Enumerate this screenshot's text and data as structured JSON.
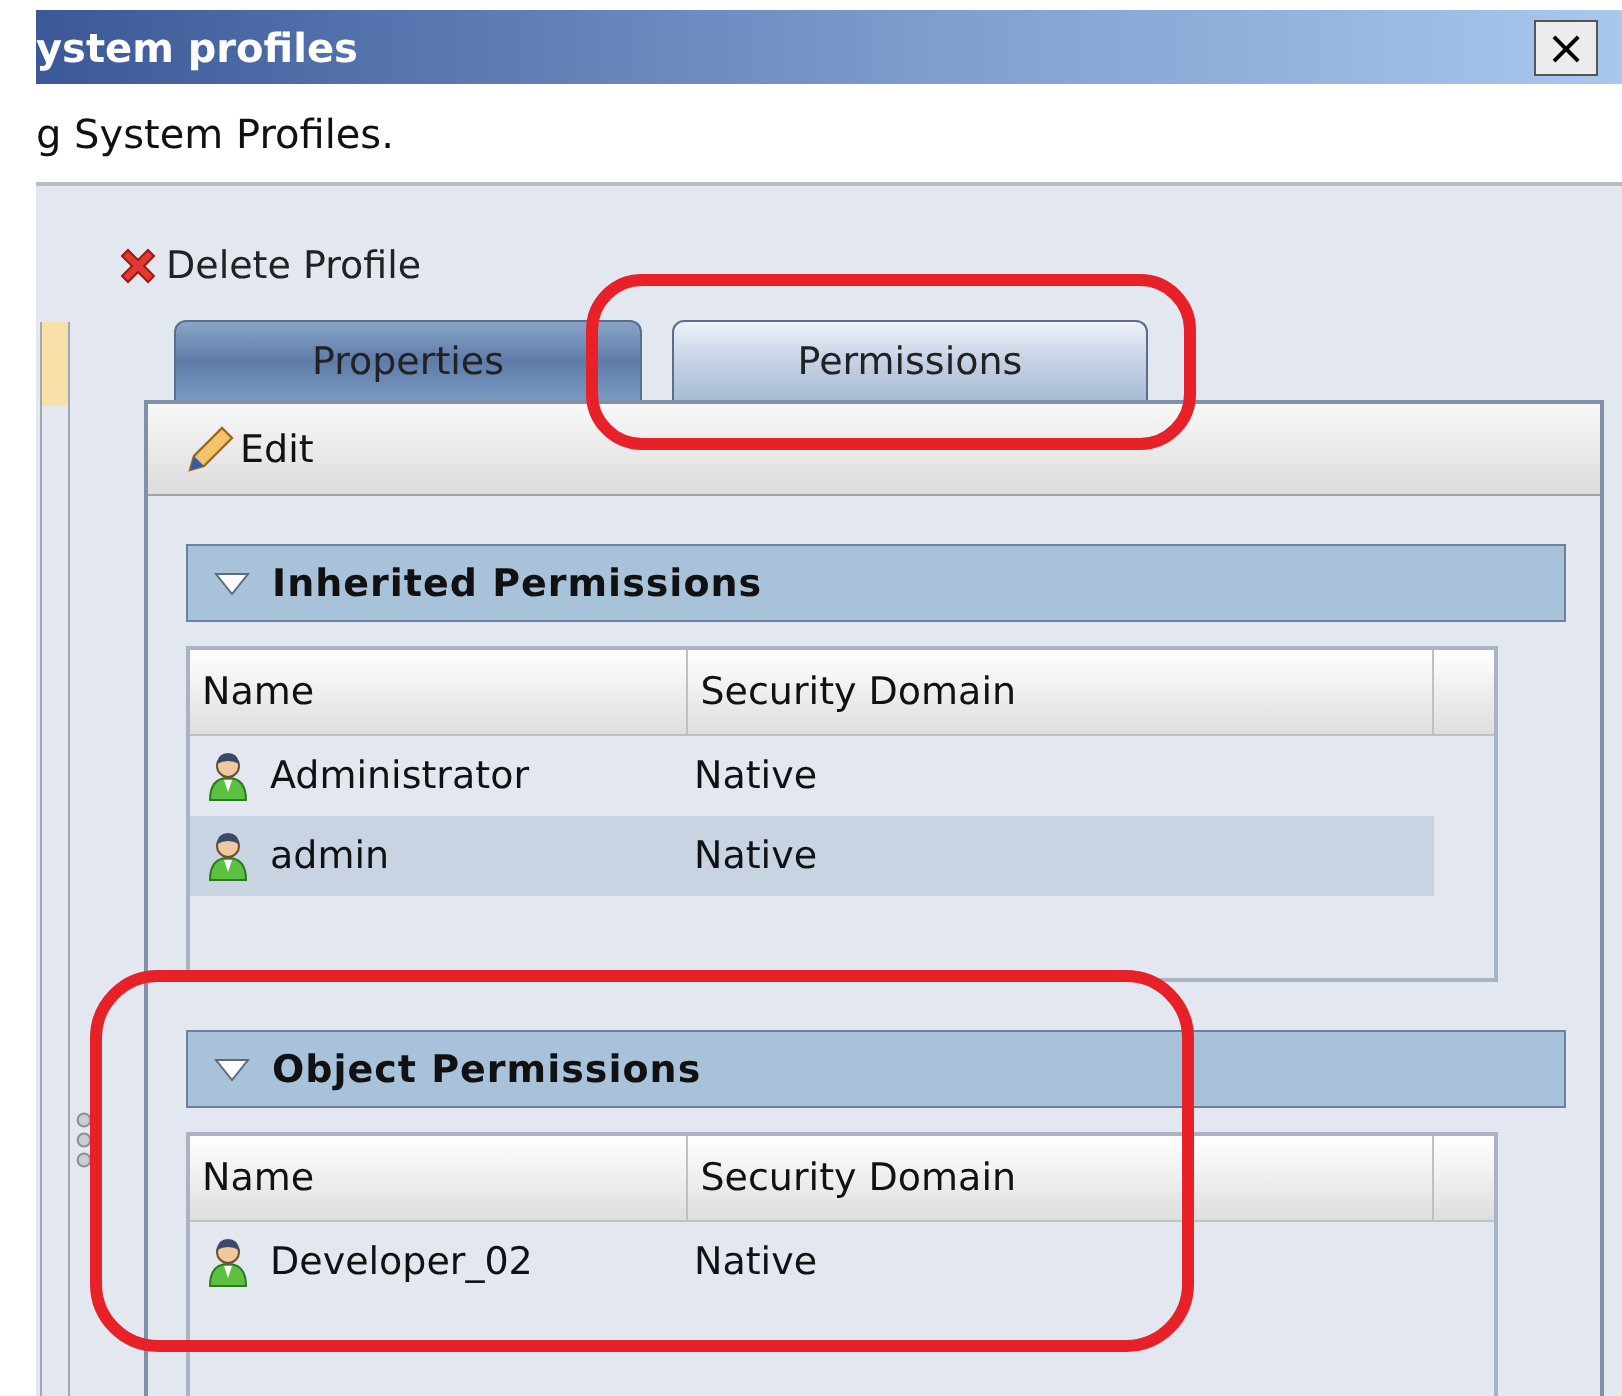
{
  "window": {
    "title": "ystem profiles",
    "close": "×"
  },
  "subtitle": "g System Profiles.",
  "toolbar": {
    "delete": "Delete Profile"
  },
  "tabs": [
    {
      "label": "Properties",
      "selected": false
    },
    {
      "label": "Permissions",
      "selected": true
    }
  ],
  "annotations": {
    "tab_circled": true,
    "section_circled": true
  },
  "panel_toolbar": {
    "edit": "Edit"
  },
  "sections": [
    {
      "title": "Inherited Permissions",
      "expanded": true,
      "columns": [
        "Name",
        "Security Domain"
      ],
      "rows": [
        {
          "name": "Administrator",
          "domain": "Native",
          "selected": false
        },
        {
          "name": "admin",
          "domain": "Native",
          "selected": true
        }
      ]
    },
    {
      "title": "Object Permissions",
      "expanded": true,
      "columns": [
        "Name",
        "Security Domain"
      ],
      "rows": [
        {
          "name": "Developer_02",
          "domain": "Native",
          "selected": false
        }
      ]
    }
  ]
}
